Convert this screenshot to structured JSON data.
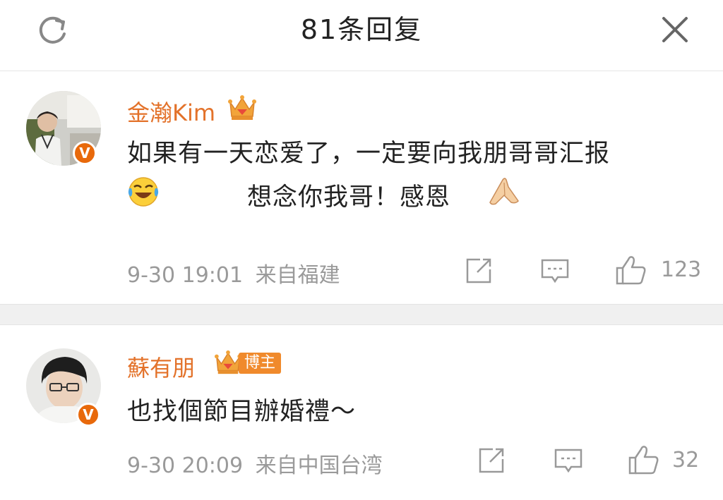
{
  "header": {
    "title": "81条回复",
    "refresh_icon": "refresh-icon",
    "close_icon": "close-icon"
  },
  "comments": [
    {
      "username": "金瀚Kim",
      "verified_badge": "V",
      "text_line1": "如果有一天恋爱了，一定要向我朋哥哥汇报",
      "text_line2": "想念你我哥！感恩",
      "emojis": [
        "laughing-crying-emoji",
        "praying-hands-emoji"
      ],
      "date": "9-30 19:01",
      "location": "来自福建",
      "likes": "123"
    },
    {
      "username": "蘇有朋",
      "badge": "博主",
      "verified_badge": "V",
      "text": "也找個節目辦婚禮～",
      "date": "9-30 20:09",
      "location": "来自中国台湾",
      "likes": "32"
    }
  ],
  "colors": {
    "username": "#e3722a",
    "meta": "#9a9a9a",
    "verified": "#e8690b",
    "divider": "#f0f0f0"
  }
}
